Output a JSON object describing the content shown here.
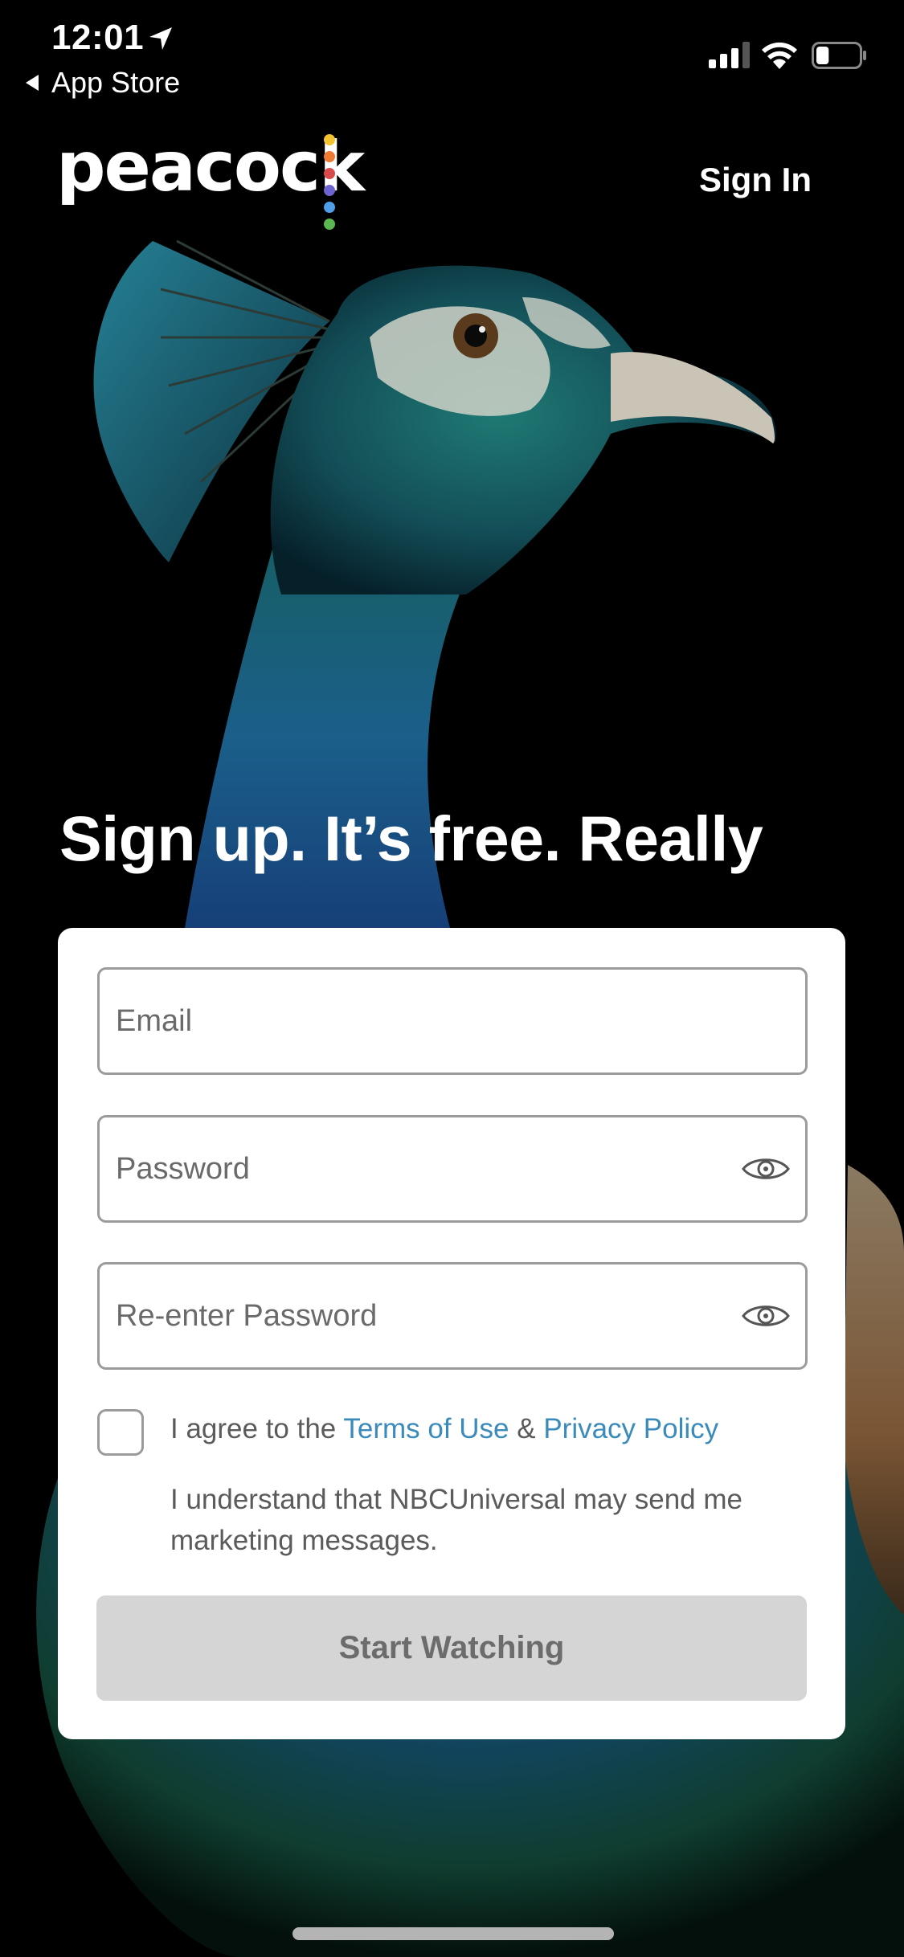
{
  "status_bar": {
    "time": "12:01",
    "back_app": "App Store",
    "signal_bars_active": 3,
    "signal_bars_total": 4,
    "battery_level": 0.3
  },
  "header": {
    "brand": "peacock",
    "brand_dot_colors": [
      "#f4c430",
      "#ef7a34",
      "#d94a4a",
      "#6c64d1",
      "#4f9ee8",
      "#5bb74f"
    ],
    "sign_in_label": "Sign In"
  },
  "headline": "Sign up. It’s free. Really",
  "form": {
    "email": {
      "placeholder": "Email",
      "value": ""
    },
    "password": {
      "placeholder": "Password",
      "value": "",
      "show_icon": "eye-icon"
    },
    "confirm_password": {
      "placeholder": "Re-enter Password",
      "value": "",
      "show_icon": "eye-icon"
    },
    "agree": {
      "checked": false,
      "prefix": "I agree to the ",
      "terms_label": "Terms of Use",
      "joiner": " & ",
      "privacy_label": "Privacy Policy"
    },
    "marketing_notice": "I understand that NBCUniversal may send me marketing messages.",
    "submit_label": "Start Watching",
    "submit_enabled": false
  },
  "colors": {
    "link": "#3a8abb",
    "button_disabled_bg": "#d5d5d5",
    "button_disabled_text": "#6c6c6c",
    "field_border": "#9b9b9b"
  }
}
